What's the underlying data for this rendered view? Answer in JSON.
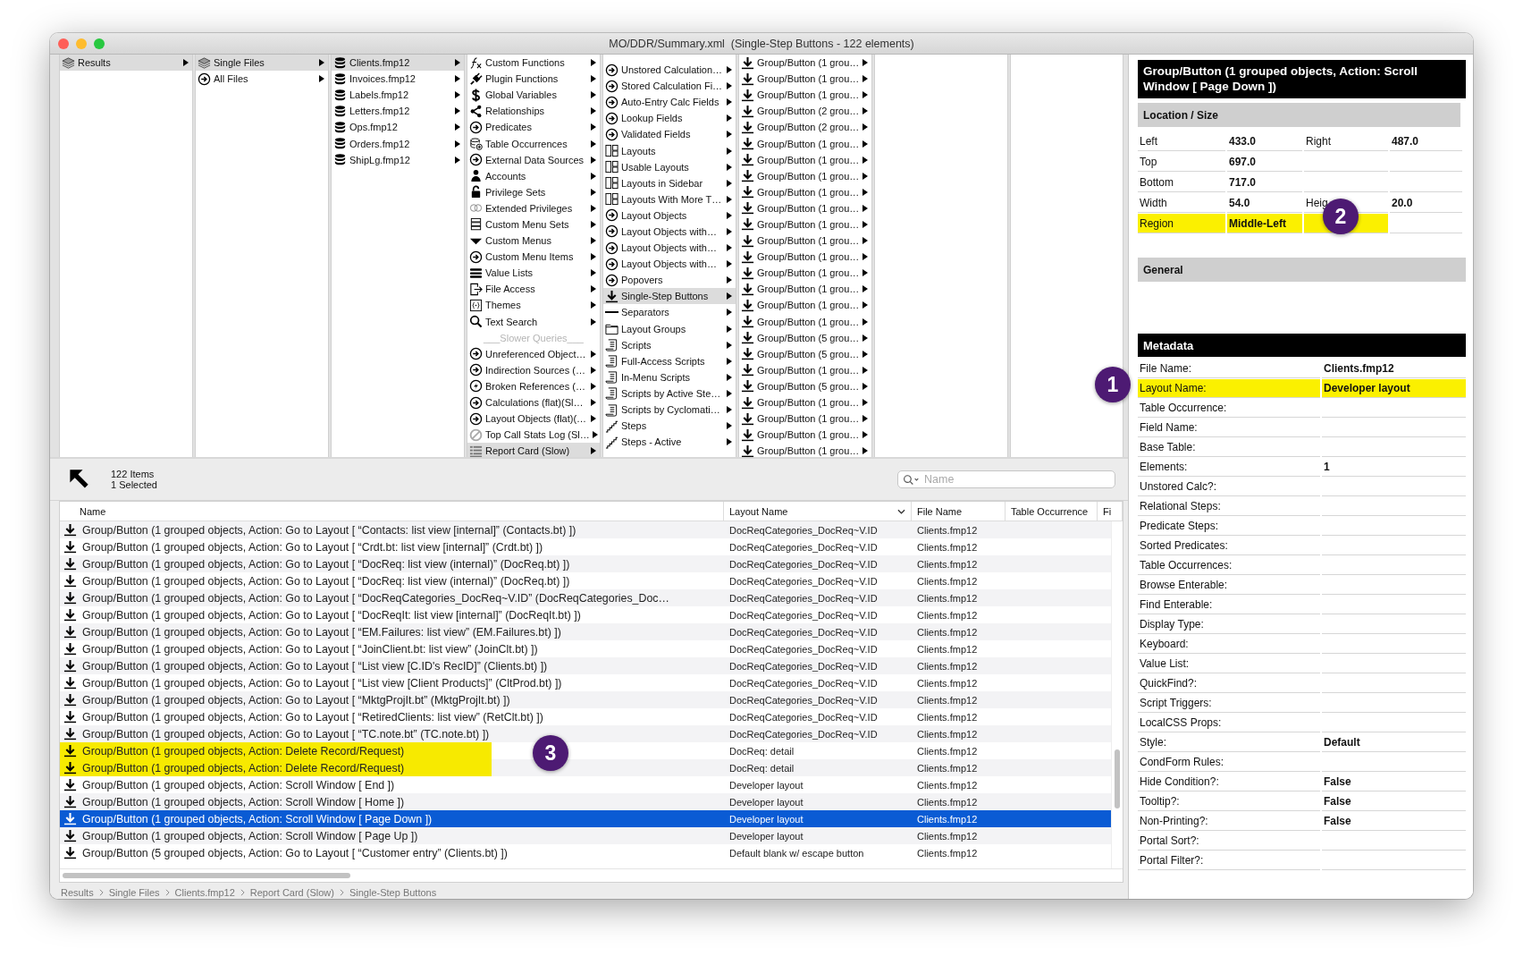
{
  "window": {
    "title": "MO/DDR/Summary.xml  (Single-Step Buttons - 122 elements)"
  },
  "browser": {
    "columns": [
      {
        "items": [
          {
            "label": "Results",
            "kind": "stack",
            "selected": true
          }
        ]
      },
      {
        "items": [
          {
            "label": "Single Files",
            "kind": "stack",
            "selected": true
          },
          {
            "label": "All Files",
            "kind": "circle",
            "selected": false
          }
        ]
      },
      {
        "items": [
          {
            "label": "Clients.fmp12",
            "kind": "database",
            "selected": true
          },
          {
            "label": "Invoices.fmp12",
            "kind": "database",
            "selected": false
          },
          {
            "label": "Labels.fmp12",
            "kind": "database",
            "selected": false
          },
          {
            "label": "Letters.fmp12",
            "kind": "database",
            "selected": false
          },
          {
            "label": "Ops.fmp12",
            "kind": "database",
            "selected": false
          },
          {
            "label": "Orders.fmp12",
            "kind": "database",
            "selected": false
          },
          {
            "label": "ShipLg.fmp12",
            "kind": "database",
            "selected": false
          }
        ]
      },
      {
        "items": [
          {
            "label": "Custom Functions",
            "kind": "fx",
            "selected": false
          },
          {
            "label": "Plugin Functions",
            "kind": "plug",
            "selected": false
          },
          {
            "label": "Global Variables",
            "kind": "dollar",
            "selected": false
          },
          {
            "label": "Relationships",
            "kind": "share",
            "selected": false
          },
          {
            "label": "Predicates",
            "kind": "circle",
            "selected": false
          },
          {
            "label": "Table Occurrences",
            "kind": "tableplus",
            "selected": false
          },
          {
            "label": "External Data Sources",
            "kind": "circle",
            "selected": false
          },
          {
            "label": "Accounts",
            "kind": "person",
            "selected": false
          },
          {
            "label": "Privilege Sets",
            "kind": "lock",
            "selected": false
          },
          {
            "label": "Extended Privileges",
            "kind": "rings",
            "selected": false
          },
          {
            "label": "Custom Menu Sets",
            "kind": "menusets",
            "selected": false
          },
          {
            "label": "Custom Menus",
            "kind": "triangle",
            "selected": false
          },
          {
            "label": "Custom Menu Items",
            "kind": "circle",
            "selected": false
          },
          {
            "label": "Value Lists",
            "kind": "lines",
            "selected": false
          },
          {
            "label": "File Access",
            "kind": "fileaccess",
            "selected": false
          },
          {
            "label": "Themes",
            "kind": "braces",
            "selected": false
          },
          {
            "label": "Text Search",
            "kind": "search",
            "selected": false
          },
          {
            "label": "___Slower Queries___",
            "kind": "heading",
            "selected": false
          },
          {
            "label": "Unreferenced Object…",
            "kind": "circle",
            "selected": false
          },
          {
            "label": "Indirection Sources (…",
            "kind": "circle",
            "selected": false
          },
          {
            "label": "Broken References (…",
            "kind": "bolt",
            "selected": false
          },
          {
            "label": "Calculations (flat)(Sl…",
            "kind": "circle",
            "selected": false
          },
          {
            "label": "Layout Objects (flat)(…",
            "kind": "circle",
            "selected": false
          },
          {
            "label": "Top Call Stats Log (Sl…",
            "kind": "forbidden",
            "selected": false
          },
          {
            "label": "Report Card (Slow)",
            "kind": "report",
            "selected": true
          }
        ]
      },
      {
        "items": [
          {
            "label": "Unstored Calculation…",
            "kind": "circle",
            "selected": false
          },
          {
            "label": "Stored Calculation Fi…",
            "kind": "circle",
            "selected": false
          },
          {
            "label": "Auto-Entry Calc Fields",
            "kind": "circle",
            "selected": false
          },
          {
            "label": "Lookup Fields",
            "kind": "circle",
            "selected": false
          },
          {
            "label": "Validated Fields",
            "kind": "circle",
            "selected": false
          },
          {
            "label": "Layouts",
            "kind": "layout",
            "selected": false
          },
          {
            "label": "Usable Layouts",
            "kind": "layout",
            "selected": false
          },
          {
            "label": "Layouts in Sidebar",
            "kind": "layout",
            "selected": false
          },
          {
            "label": "Layouts With More T…",
            "kind": "layout",
            "selected": false
          },
          {
            "label": "Layout Objects",
            "kind": "circle",
            "selected": false
          },
          {
            "label": "Layout Objects with…",
            "kind": "circle",
            "selected": false
          },
          {
            "label": "Layout Objects with…",
            "kind": "circle",
            "selected": false
          },
          {
            "label": "Layout Objects with…",
            "kind": "circle",
            "selected": false
          },
          {
            "label": "Popovers",
            "kind": "circle",
            "selected": false
          },
          {
            "label": "Single-Step Buttons",
            "kind": "button",
            "selected": true
          },
          {
            "label": "Separators",
            "kind": "separator",
            "selected": false
          },
          {
            "label": "Layout Groups",
            "kind": "folder",
            "selected": false
          },
          {
            "label": "Scripts",
            "kind": "script",
            "selected": false
          },
          {
            "label": "Full-Access Scripts",
            "kind": "script",
            "selected": false
          },
          {
            "label": "In-Menu Scripts",
            "kind": "script",
            "selected": false
          },
          {
            "label": "Scripts by Active Ste…",
            "kind": "script",
            "selected": false
          },
          {
            "label": "Scripts by Cyclomati…",
            "kind": "script",
            "selected": false
          },
          {
            "label": "Steps",
            "kind": "steps",
            "selected": false
          },
          {
            "label": "Steps - Active",
            "kind": "steps",
            "selected": false
          }
        ]
      },
      {
        "items": [
          {
            "label": "Group/Button (1 grou…",
            "kind": "button",
            "selected": false
          },
          {
            "label": "Group/Button (1 grou…",
            "kind": "button",
            "selected": false
          },
          {
            "label": "Group/Button (1 grou…",
            "kind": "button",
            "selected": false
          },
          {
            "label": "Group/Button (2 grou…",
            "kind": "button",
            "selected": false
          },
          {
            "label": "Group/Button (2 grou…",
            "kind": "button",
            "selected": false
          },
          {
            "label": "Group/Button (1 grou…",
            "kind": "button",
            "selected": false
          },
          {
            "label": "Group/Button (1 grou…",
            "kind": "button",
            "selected": false
          },
          {
            "label": "Group/Button (1 grou…",
            "kind": "button",
            "selected": false
          },
          {
            "label": "Group/Button (1 grou…",
            "kind": "button",
            "selected": false
          },
          {
            "label": "Group/Button (1 grou…",
            "kind": "button",
            "selected": false
          },
          {
            "label": "Group/Button (1 grou…",
            "kind": "button",
            "selected": false
          },
          {
            "label": "Group/Button (1 grou…",
            "kind": "button",
            "selected": false
          },
          {
            "label": "Group/Button (1 grou…",
            "kind": "button",
            "selected": false
          },
          {
            "label": "Group/Button (1 grou…",
            "kind": "button",
            "selected": false
          },
          {
            "label": "Group/Button (1 grou…",
            "kind": "button",
            "selected": false
          },
          {
            "label": "Group/Button (1 grou…",
            "kind": "button",
            "selected": false
          },
          {
            "label": "Group/Button (1 grou…",
            "kind": "button",
            "selected": false
          },
          {
            "label": "Group/Button (5 grou…",
            "kind": "button",
            "selected": false
          },
          {
            "label": "Group/Button (5 grou…",
            "kind": "button",
            "selected": false
          },
          {
            "label": "Group/Button (1 grou…",
            "kind": "button",
            "selected": false
          },
          {
            "label": "Group/Button (5 grou…",
            "kind": "button",
            "selected": false
          },
          {
            "label": "Group/Button (1 grou…",
            "kind": "button",
            "selected": false
          },
          {
            "label": "Group/Button (1 grou…",
            "kind": "button",
            "selected": false
          },
          {
            "label": "Group/Button (1 grou…",
            "kind": "button",
            "selected": false
          },
          {
            "label": "Group/Button (1 grou…",
            "kind": "button",
            "selected": false
          }
        ]
      }
    ]
  },
  "toolbar": {
    "count": "122 Items",
    "selection": "1 Selected",
    "search": {
      "placeholder": "Name"
    }
  },
  "table": {
    "columns": [
      {
        "label": "Name",
        "sorted": false
      },
      {
        "label": "Layout Name",
        "sorted": true
      },
      {
        "label": "File Name",
        "sorted": false
      },
      {
        "label": "Table Occurrence",
        "sorted": false
      },
      {
        "label": "Fi",
        "sorted": false
      }
    ],
    "rows": [
      {
        "name": "Group/Button (1 grouped objects, Action: Go to Layout [ “Contacts: list view [internal]” (Contacts.bt) ])",
        "layout": "DocReqCategories_DocReq~V.ID",
        "file": "Clients.fmp12",
        "highlighted": false,
        "selected": false
      },
      {
        "name": "Group/Button (1 grouped objects, Action: Go to Layout [ “Crdt.bt: list view [internal]” (Crdt.bt) ])",
        "layout": "DocReqCategories_DocReq~V.ID",
        "file": "Clients.fmp12",
        "highlighted": false,
        "selected": false
      },
      {
        "name": "Group/Button (1 grouped objects, Action: Go to Layout [ “DocReq: list view (internal)” (DocReq.bt) ])",
        "layout": "DocReqCategories_DocReq~V.ID",
        "file": "Clients.fmp12",
        "highlighted": false,
        "selected": false
      },
      {
        "name": "Group/Button (1 grouped objects, Action: Go to Layout [ “DocReq: list view (internal)” (DocReq.bt) ])",
        "layout": "DocReqCategories_DocReq~V.ID",
        "file": "Clients.fmp12",
        "highlighted": false,
        "selected": false
      },
      {
        "name": "Group/Button (1 grouped objects, Action: Go to Layout [ “DocReqCategories_DocReq~V.ID” (DocReqCategories_Doc…",
        "layout": "DocReqCategories_DocReq~V.ID",
        "file": "Clients.fmp12",
        "highlighted": false,
        "selected": false
      },
      {
        "name": "Group/Button (1 grouped objects, Action: Go to Layout [ “DocReqIt: list view [internal]” (DocReqIt.bt) ])",
        "layout": "DocReqCategories_DocReq~V.ID",
        "file": "Clients.fmp12",
        "highlighted": false,
        "selected": false
      },
      {
        "name": "Group/Button (1 grouped objects, Action: Go to Layout [ “EM.Failures: list view” (EM.Failures.bt) ])",
        "layout": "DocReqCategories_DocReq~V.ID",
        "file": "Clients.fmp12",
        "highlighted": false,
        "selected": false
      },
      {
        "name": "Group/Button (1 grouped objects, Action: Go to Layout [ “JoinClient.bt: list view” (JoinClt.bt) ])",
        "layout": "DocReqCategories_DocReq~V.ID",
        "file": "Clients.fmp12",
        "highlighted": false,
        "selected": false
      },
      {
        "name": "Group/Button (1 grouped objects, Action: Go to Layout [ “List view [C.ID's RecID]” (Clients.bt) ])",
        "layout": "DocReqCategories_DocReq~V.ID",
        "file": "Clients.fmp12",
        "highlighted": false,
        "selected": false
      },
      {
        "name": "Group/Button (1 grouped objects, Action: Go to Layout [ “List view [Client Products]” (CltProd.bt) ])",
        "layout": "DocReqCategories_DocReq~V.ID",
        "file": "Clients.fmp12",
        "highlighted": false,
        "selected": false
      },
      {
        "name": "Group/Button (1 grouped objects, Action: Go to Layout [ “MktgProjIt.bt” (MktgProjIt.bt) ])",
        "layout": "DocReqCategories_DocReq~V.ID",
        "file": "Clients.fmp12",
        "highlighted": false,
        "selected": false
      },
      {
        "name": "Group/Button (1 grouped objects, Action: Go to Layout [ “RetiredClients: list view” (RetClt.bt) ])",
        "layout": "DocReqCategories_DocReq~V.ID",
        "file": "Clients.fmp12",
        "highlighted": false,
        "selected": false
      },
      {
        "name": "Group/Button (1 grouped objects, Action: Go to Layout [ “TC.note.bt” (TC.note.bt) ])",
        "layout": "DocReqCategories_DocReq~V.ID",
        "file": "Clients.fmp12",
        "highlighted": false,
        "selected": false
      },
      {
        "name": "Group/Button (1 grouped objects, Action: Delete Record/Request)",
        "layout": "DocReq: detail",
        "file": "Clients.fmp12",
        "highlighted": true,
        "selected": false
      },
      {
        "name": "Group/Button (1 grouped objects, Action: Delete Record/Request)",
        "layout": "DocReq: detail",
        "file": "Clients.fmp12",
        "highlighted": true,
        "selected": false
      },
      {
        "name": "Group/Button (1 grouped objects, Action: Scroll Window [ End ])",
        "layout": "Developer layout",
        "file": "Clients.fmp12",
        "highlighted": false,
        "selected": false
      },
      {
        "name": "Group/Button (1 grouped objects, Action: Scroll Window [ Home ])",
        "layout": "Developer layout",
        "file": "Clients.fmp12",
        "highlighted": false,
        "selected": false
      },
      {
        "name": "Group/Button (1 grouped objects, Action: Scroll Window [ Page Down ])",
        "layout": "Developer layout",
        "file": "Clients.fmp12",
        "highlighted": false,
        "selected": true
      },
      {
        "name": "Group/Button (1 grouped objects, Action: Scroll Window [ Page Up ])",
        "layout": "Developer layout",
        "file": "Clients.fmp12",
        "highlighted": false,
        "selected": false
      },
      {
        "name": "Group/Button (5 grouped objects, Action: Go to Layout [ “Customer entry” (Clients.bt) ])",
        "layout": "Default blank w/ escape button",
        "file": "Clients.fmp12",
        "highlighted": false,
        "selected": false
      }
    ]
  },
  "breadcrumb": [
    "Results",
    "Single Files",
    "Clients.fmp12",
    "Report Card (Slow)",
    "Single-Step Buttons"
  ],
  "inspector": {
    "title": "Group/Button (1 grouped objects, Action: Scroll Window [ Page Down ])",
    "location": {
      "heading": "Location / Size",
      "rows": [
        {
          "label": "Left",
          "value": "433.0",
          "label2": "Right",
          "value2": "487.0",
          "highlighted": false
        },
        {
          "label": "Top",
          "value": "697.0",
          "highlighted": false
        },
        {
          "label": "Bottom",
          "value": "717.0",
          "highlighted": false
        },
        {
          "label": "Width",
          "value": "54.0",
          "label2": "Heig",
          "value2": "20.0",
          "highlighted": false
        },
        {
          "label": "Region",
          "value": "Middle-Left",
          "highlighted": true
        }
      ]
    },
    "general": {
      "heading": "General"
    },
    "metadata": {
      "heading": "Metadata",
      "rows": [
        {
          "label": "File Name:",
          "value": "Clients.fmp12",
          "highlighted": false
        },
        {
          "label": "Layout Name:",
          "value": "Developer layout",
          "highlighted": true
        },
        {
          "label": "Table Occurrence:",
          "highlighted": false
        },
        {
          "label": "Field Name:",
          "highlighted": false
        },
        {
          "label": "Base Table:",
          "highlighted": false
        },
        {
          "label": "Elements:",
          "value": "1",
          "highlighted": false
        },
        {
          "label": "Unstored Calc?:",
          "highlighted": false
        },
        {
          "label": "Relational Steps:",
          "highlighted": false
        },
        {
          "label": "Predicate Steps:",
          "highlighted": false
        },
        {
          "label": "Sorted Predicates:",
          "highlighted": false
        },
        {
          "label": "Table Occurrences:",
          "highlighted": false
        },
        {
          "label": "Browse Enterable:",
          "highlighted": false
        },
        {
          "label": "Find Enterable:",
          "highlighted": false
        },
        {
          "label": "Display Type:",
          "highlighted": false
        },
        {
          "label": "Keyboard:",
          "highlighted": false
        },
        {
          "label": "Value List:",
          "highlighted": false
        },
        {
          "label": "QuickFind?:",
          "highlighted": false
        },
        {
          "label": "Script Triggers:",
          "highlighted": false
        },
        {
          "label": "LocalCSS Props:",
          "highlighted": false
        },
        {
          "label": "Style:",
          "value": "Default",
          "highlighted": false
        },
        {
          "label": "CondForm Rules:",
          "highlighted": false
        },
        {
          "label": "Hide Condition?:",
          "value": "False",
          "highlighted": false
        },
        {
          "label": "Tooltip?:",
          "value": "False",
          "highlighted": false
        },
        {
          "label": "Non-Printing?:",
          "value": "False",
          "highlighted": false
        },
        {
          "label": "Portal Sort?:",
          "highlighted": false
        },
        {
          "label": "Portal Filter?:",
          "highlighted": false
        }
      ]
    }
  },
  "callouts": [
    "1",
    "2",
    "3"
  ]
}
